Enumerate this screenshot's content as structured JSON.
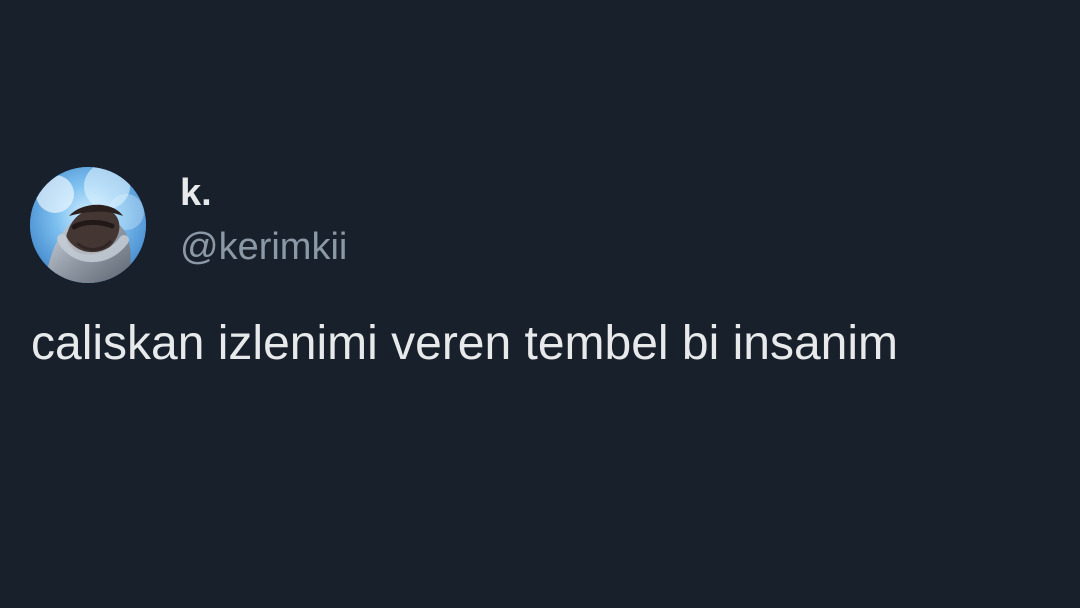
{
  "tweet": {
    "display_name": "k.",
    "handle": "@kerimkii",
    "text": "caliskan izlenimi veren tembel bi insanim"
  },
  "avatar": {
    "description_icon": "profile-photo-icon"
  },
  "colors": {
    "background": "#18202b",
    "primary_text": "#e7e9ea",
    "secondary_text": "#8b98a5",
    "avatar_sky": "#3f86d0"
  }
}
